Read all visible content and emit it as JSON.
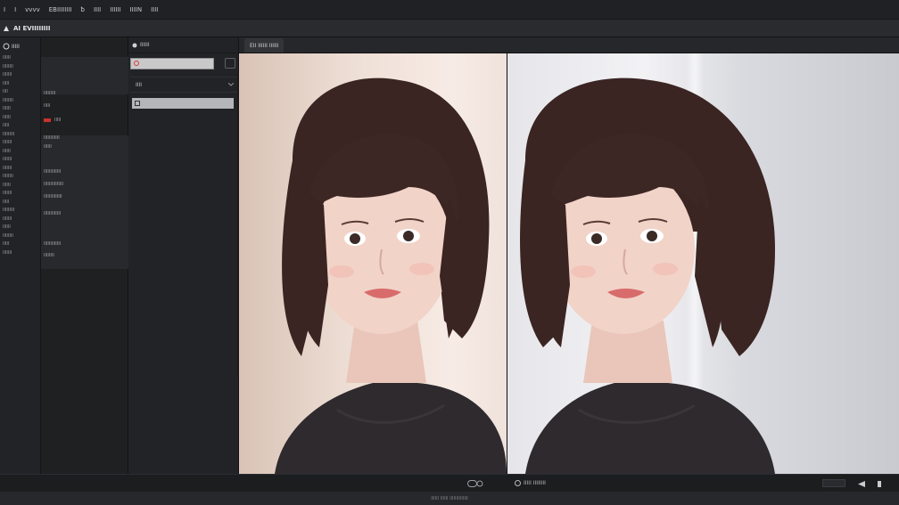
{
  "topbar": {
    "menu": [
      "I",
      "I",
      "vvvv",
      "EBIIIIIIII",
      "ƀ",
      "IIII",
      "IIIIII",
      "IIIIN",
      "IIII",
      "IIIIII"
    ]
  },
  "titlebar": {
    "title": "AI EVIIIIIIII"
  },
  "left_rail": {
    "header": "IIIII",
    "items": [
      "IIIIII",
      "IIIIIIII",
      "IIIIIII",
      "IIIII",
      "IIII",
      "IIIIIIII",
      "IIIIII",
      "IIIIII",
      "IIIII",
      "IIIIIIIII",
      "IIIIIII",
      "IIIIII",
      "IIIIIII",
      "IIIIIII",
      "IIIIIIII",
      "IIIIII",
      "IIIIIII",
      "IIIII",
      "IIIIIIIII",
      "IIIIIII",
      "IIIIII",
      "IIIIIIII",
      "IIIII",
      "IIIIIII"
    ]
  },
  "props": {
    "rows": [
      "IIIIIIIII",
      "IIIII",
      "IIIII",
      "IIIIIIIIIIII",
      "IIIIII",
      "IIIIIIIIIIIII",
      "IIIIIIIIIIIIIII",
      "IIIIIIIIIIIIII",
      "IIIIIIIIIIIII",
      "IIIIIIIIIIIII",
      "IIIIIIII"
    ]
  },
  "layers": {
    "header": "IIIIII",
    "field_value": "",
    "dropdown_label": "IIII",
    "selected_layer": ""
  },
  "canvas": {
    "tab_label": "EII IIIIII IIIIII"
  },
  "statusbar": {
    "left_text": "IIII",
    "center_text": "IIIII IIIIIIII",
    "bottom_text": "IIIIII IIIIII IIIIIIIIIIIIII"
  },
  "colors": {
    "accent_red": "#c8322e",
    "panel_bg": "#222326",
    "topbar_bg": "#202124"
  }
}
